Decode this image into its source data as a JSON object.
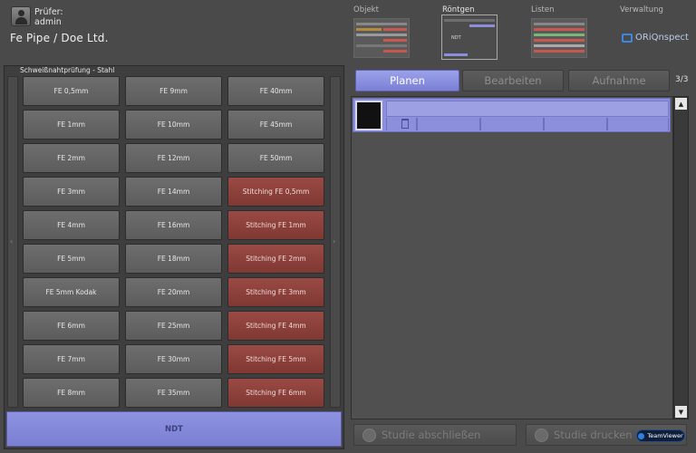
{
  "header": {
    "user_label": "Prüfer:",
    "user_name": "admin",
    "company": "Fe Pipe / Doe Ltd.",
    "nav": [
      {
        "label": "Objekt"
      },
      {
        "label": "Röntgen"
      },
      {
        "label": "Listen"
      },
      {
        "label": "Verwaltung"
      }
    ],
    "thumb_ndt": "NDT",
    "brand": "ORiQnspect"
  },
  "left_panel": {
    "title": "Schweißnahtprüfung - Stahl",
    "columns": [
      [
        "FE 0,5mm",
        "FE 1mm",
        "FE 2mm",
        "FE 3mm",
        "FE 4mm",
        "FE 5mm",
        "FE 5mm Kodak",
        "FE 6mm",
        "FE 7mm",
        "FE 8mm"
      ],
      [
        "FE 9mm",
        "FE 10mm",
        "FE 12mm",
        "FE 14mm",
        "FE 16mm",
        "FE 18mm",
        "FE 20mm",
        "FE 25mm",
        "FE 30mm",
        "FE 35mm"
      ],
      [
        "FE 40mm",
        "FE 45mm",
        "FE 50mm",
        "Stitching FE 0,5mm",
        "Stitching FE 1mm",
        "Stitching FE 2mm",
        "Stitching FE 3mm",
        "Stitching FE 4mm",
        "Stitching FE 5mm",
        "Stitching FE 6mm"
      ]
    ],
    "ndt_label": "NDT"
  },
  "tabs": [
    {
      "label": "Planen",
      "active": true
    },
    {
      "label": "Bearbeiten",
      "active": false
    },
    {
      "label": "Aufnahme",
      "active": false
    }
  ],
  "page_counter": "3/3",
  "footer": {
    "finish_label": "Studie abschließen",
    "print_label": "Studie drucken",
    "teamviewer": "TeamViewer"
  },
  "colors": {
    "accent": "#8c90dc",
    "stitching": "#8c3f3a",
    "background": "#4a4a4a"
  }
}
